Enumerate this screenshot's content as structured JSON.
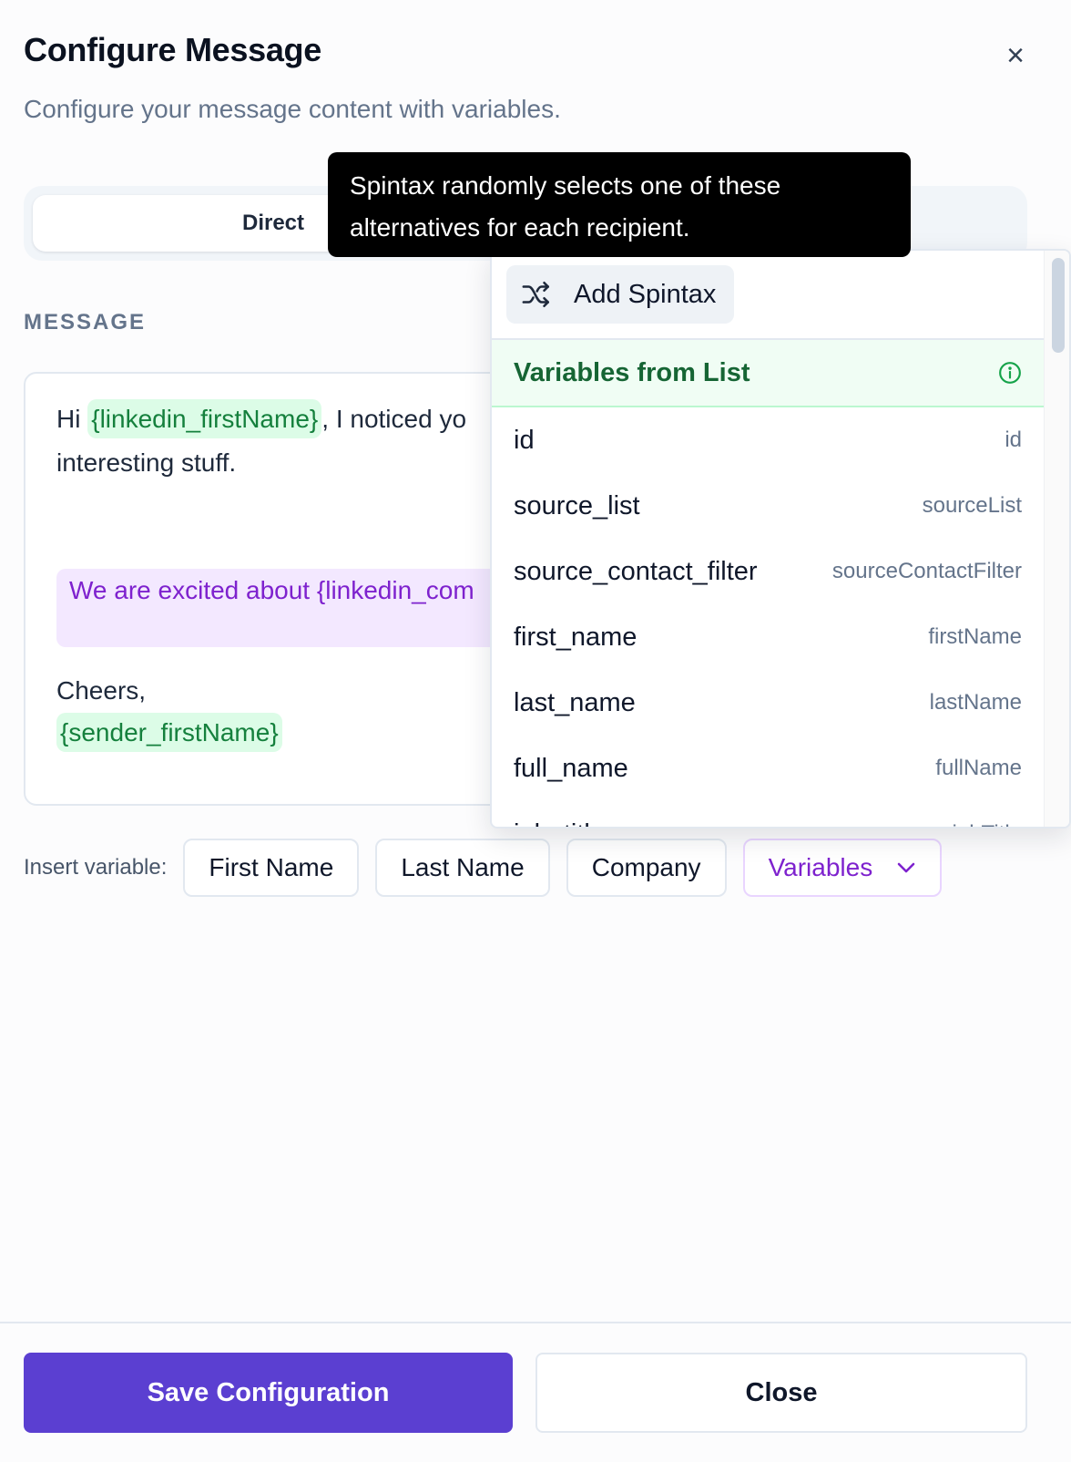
{
  "dialog": {
    "title": "Configure Message",
    "description": "Configure your message content with variables.",
    "close_icon": "close-icon"
  },
  "tabs": [
    {
      "label": "Direct",
      "active": true
    }
  ],
  "tooltip": {
    "text": "Spintax randomly selects one of these alternatives for each recipient."
  },
  "message": {
    "section_label": "MESSAGE",
    "line1_prefix": "Hi ",
    "line1_variable": "{linkedin_firstName}",
    "line1_suffix": ", I noticed yo",
    "line2": "interesting stuff.",
    "spintax_text": "We are excited about {linkedin_com",
    "closing": "Cheers,",
    "signature_variable": "{sender_firstName}"
  },
  "insert_variable": {
    "label": "Insert variable:",
    "buttons": [
      "First Name",
      "Last Name",
      "Company"
    ],
    "variables_button": "Variables"
  },
  "dropdown": {
    "spintax_button": "Add Spintax",
    "group_title": "Variables from List",
    "items": [
      {
        "name": "id",
        "key": "id"
      },
      {
        "name": "source_list",
        "key": "sourceList"
      },
      {
        "name": "source_contact_filter",
        "key": "sourceContactFilter"
      },
      {
        "name": "first_name",
        "key": "firstName"
      },
      {
        "name": "last_name",
        "key": "lastName"
      },
      {
        "name": "full_name",
        "key": "fullName"
      },
      {
        "name": "job_title",
        "key": "jobTitle"
      }
    ]
  },
  "footer": {
    "save_label": "Save Configuration",
    "close_label": "Close"
  },
  "colors": {
    "primary": "#5b3fd1",
    "variable_green": "#15803d",
    "variable_green_bg": "#dcfce7",
    "spintax_purple": "#7e22ce",
    "spintax_bg": "#f3e8ff"
  }
}
